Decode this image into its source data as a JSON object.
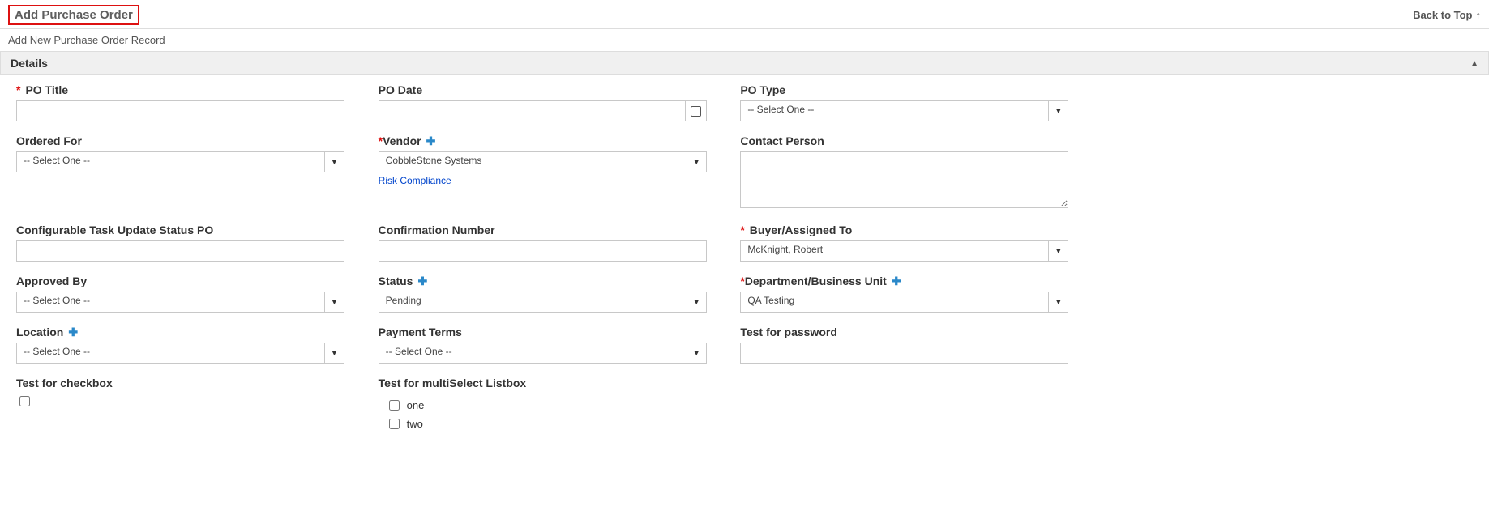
{
  "header": {
    "title": "Add Purchase Order",
    "back_to_top": "Back to Top"
  },
  "subtitle": "Add New Purchase Order Record",
  "section": {
    "title": "Details"
  },
  "select_one": "-- Select One --",
  "fields": {
    "po_title": {
      "label": "PO Title",
      "value": ""
    },
    "po_date": {
      "label": "PO Date",
      "value": ""
    },
    "po_type": {
      "label": "PO Type",
      "value": "-- Select One --"
    },
    "ordered_for": {
      "label": "Ordered For",
      "value": "-- Select One --"
    },
    "vendor": {
      "label": "Vendor",
      "value": "CobbleStone Systems",
      "link": "Risk Compliance"
    },
    "contact_person": {
      "label": "Contact Person",
      "value": ""
    },
    "config_task": {
      "label": "Configurable Task Update Status PO",
      "value": ""
    },
    "confirmation": {
      "label": "Confirmation Number",
      "value": ""
    },
    "buyer": {
      "label": "Buyer/Assigned To",
      "value": "McKnight, Robert"
    },
    "approved_by": {
      "label": "Approved By",
      "value": "-- Select One --"
    },
    "status": {
      "label": "Status",
      "value": "Pending"
    },
    "dept": {
      "label": "Department/Business Unit",
      "value": "QA Testing"
    },
    "location": {
      "label": "Location",
      "value": "-- Select One --"
    },
    "payment_terms": {
      "label": "Payment Terms",
      "value": "-- Select One --"
    },
    "test_password": {
      "label": "Test for password",
      "value": ""
    },
    "test_checkbox": {
      "label": "Test for checkbox"
    },
    "multi_listbox": {
      "label": "Test for multiSelect Listbox",
      "options": [
        "one",
        "two"
      ]
    }
  }
}
